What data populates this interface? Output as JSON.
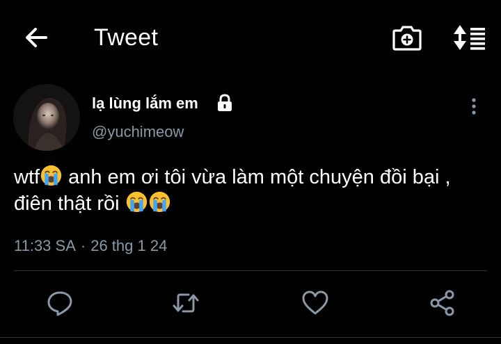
{
  "header": {
    "title": "Tweet",
    "back_icon": "arrow-left-icon",
    "camera_icon": "camera-add-icon",
    "sort_icon": "sort-arrows-list-icon"
  },
  "tweet": {
    "display_name": "lạ lùng lắm em",
    "protected_icon": "lock-icon",
    "username": "@yuchimeow",
    "text_part1": "wtf",
    "text_part2": " anh em ơi tôi vừa làm một chuyện đồi bại , điên thật rồi ",
    "emoji_name": "loudly-crying-face-emoji",
    "time": "11:33 SA",
    "separator": "·",
    "date": "26 thg 1 24"
  },
  "actions": {
    "reply_icon": "reply-icon",
    "retweet_icon": "retweet-icon",
    "like_icon": "heart-icon",
    "share_icon": "share-icon"
  },
  "colors": {
    "background": "#000000",
    "text": "#ffffff",
    "secondary": "#8b98a5",
    "divider": "#2f3336",
    "emoji_face": "#fbc02d",
    "emoji_tears": "#42a5f5"
  }
}
